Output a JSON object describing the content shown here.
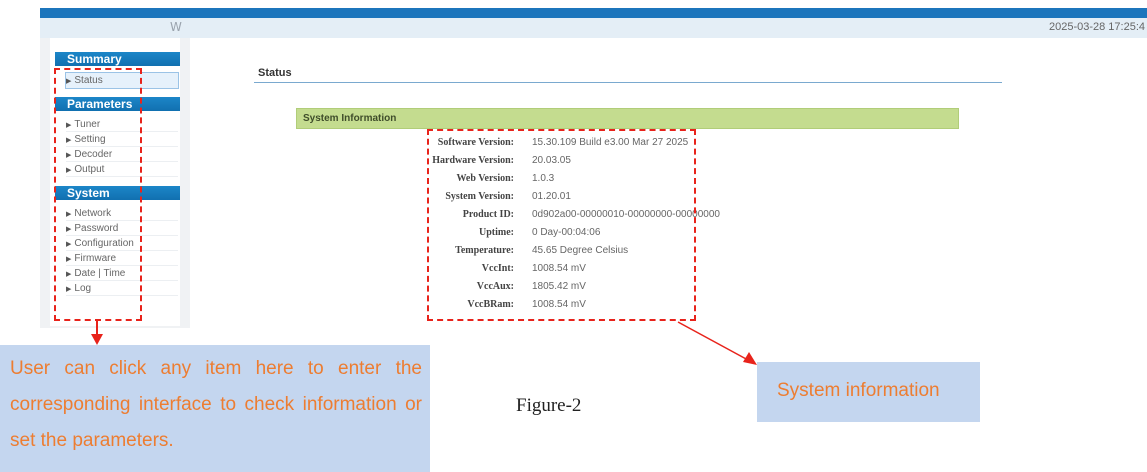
{
  "header": {
    "title": "W",
    "datetime": "2025-03-28 17:25:4"
  },
  "sidebar": {
    "summary": {
      "heading": "Summary",
      "items": [
        {
          "label": "Status"
        }
      ]
    },
    "parameters": {
      "heading": "Parameters",
      "items": [
        {
          "label": "Tuner"
        },
        {
          "label": "Setting"
        },
        {
          "label": "Decoder"
        },
        {
          "label": "Output"
        }
      ]
    },
    "system": {
      "heading": "System",
      "items": [
        {
          "label": "Network"
        },
        {
          "label": "Password"
        },
        {
          "label": "Configuration"
        },
        {
          "label": "Firmware"
        },
        {
          "label": "Date | Time"
        },
        {
          "label": "Log"
        }
      ]
    }
  },
  "main": {
    "page_title": "Status",
    "section_title": "System Information",
    "rows": [
      {
        "key": "Software Version:",
        "value": "15.30.109 Build e3.00 Mar 27 2025"
      },
      {
        "key": "Hardware Version:",
        "value": "20.03.05"
      },
      {
        "key": "Web Version:",
        "value": "1.0.3"
      },
      {
        "key": "System Version:",
        "value": "01.20.01"
      },
      {
        "key": "Product ID:",
        "value": "0d902a00-00000010-00000000-00000000"
      },
      {
        "key": "Uptime:",
        "value": "0 Day-00:04:06"
      },
      {
        "key": "Temperature:",
        "value": "45.65 Degree Celsius"
      },
      {
        "key": "VccInt:",
        "value": "1008.54 mV"
      },
      {
        "key": "VccAux:",
        "value": "1805.42 mV"
      },
      {
        "key": "VccBRam:",
        "value": "1008.54 mV"
      }
    ]
  },
  "annotations": {
    "left_callout": "User can click any item here to enter the corresponding interface to check information or set the parameters.",
    "right_callout": "System information",
    "figure_caption": "Figure-2"
  },
  "colors": {
    "header_blue": "#1c75bc",
    "section_green": "#c4dc8f",
    "annotation_red": "#e8231b",
    "callout_bg": "#c4d6ef",
    "callout_text": "#ed7d31"
  },
  "icons": {
    "menu_bullet": "triangle-right-icon"
  }
}
